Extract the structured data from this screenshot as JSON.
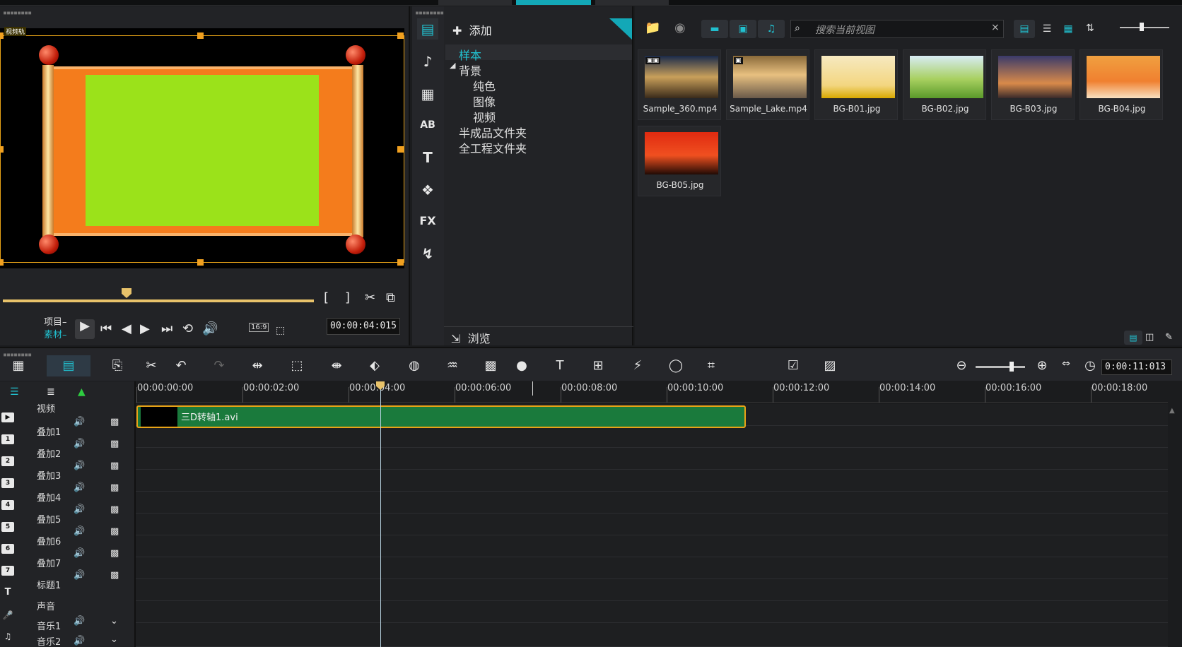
{
  "player": {
    "preview_label": "视频轨",
    "project_label": "项目–",
    "clip_label": "素材–",
    "ratio": "16:9",
    "timecode": "00:00:04:015",
    "mark_in": "[",
    "mark_out": "]"
  },
  "library": {
    "add_label": "添加",
    "browse_label": "浏览",
    "search_placeholder": "搜索当前视图",
    "tree": [
      {
        "label": "样本",
        "level": 0,
        "selected": true
      },
      {
        "label": "背景",
        "level": 0,
        "expanded": true
      },
      {
        "label": "纯色",
        "level": 1
      },
      {
        "label": "图像",
        "level": 1
      },
      {
        "label": "视频",
        "level": 1
      },
      {
        "label": "半成品文件夹",
        "level": 0
      },
      {
        "label": "全工程文件夹",
        "level": 0
      }
    ],
    "items": [
      {
        "name": "Sample_360.mp4",
        "kind": "video"
      },
      {
        "name": "Sample_Lake.mp4",
        "kind": "video"
      },
      {
        "name": "BG-B01.jpg",
        "kind": "image"
      },
      {
        "name": "BG-B02.jpg",
        "kind": "image"
      },
      {
        "name": "BG-B03.jpg",
        "kind": "image"
      },
      {
        "name": "BG-B04.jpg",
        "kind": "image"
      },
      {
        "name": "BG-B05.jpg",
        "kind": "image"
      }
    ]
  },
  "timeline": {
    "timecode": "0:00:11:013",
    "ruler": [
      "00:00:00:00",
      "00:00:02:00",
      "00:00:04:00",
      "00:00:06:00",
      "00:00:08:00",
      "00:00:10:00",
      "00:00:12:00",
      "00:00:14:00",
      "00:00:16:00",
      "00:00:18:00"
    ],
    "clip_name": "三D转轴1.avi",
    "tracks": [
      {
        "num": "",
        "name": "视频"
      },
      {
        "num": "1",
        "name": "叠加1"
      },
      {
        "num": "2",
        "name": "叠加2"
      },
      {
        "num": "3",
        "name": "叠加3"
      },
      {
        "num": "4",
        "name": "叠加4"
      },
      {
        "num": "5",
        "name": "叠加5"
      },
      {
        "num": "6",
        "name": "叠加6"
      },
      {
        "num": "7",
        "name": "叠加7"
      },
      {
        "num": "T",
        "name": "标题1"
      },
      {
        "num": "",
        "name": "声音"
      },
      {
        "num": "",
        "name": "音乐1"
      },
      {
        "num": "",
        "name": "音乐2"
      }
    ]
  },
  "colors": {
    "accent": "#13a8b7",
    "clip": "#1a7a3c",
    "selection": "#e8a317"
  }
}
